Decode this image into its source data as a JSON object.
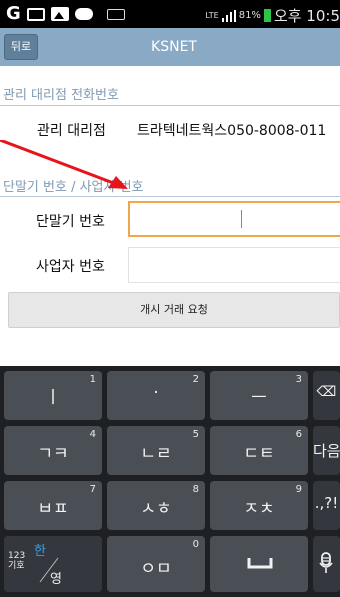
{
  "status_bar": {
    "signal_type": "LTE",
    "battery_percent": "81%",
    "time": "오후 10:5"
  },
  "app": {
    "title": "KSNET",
    "back_label": "뒤로"
  },
  "sections": {
    "manager": {
      "header": "관리 대리점 전화번호",
      "label": "관리 대리점",
      "value": "트라텍네트웍스050-8008-011"
    },
    "terminal": {
      "header": "단말기 번호 / 사업자 번호",
      "terminal_label": "단말기 번호",
      "terminal_value": "",
      "business_label": "사업자 번호",
      "business_value": ""
    }
  },
  "actions": {
    "open_request": "개시 거래 요청"
  },
  "keyboard": {
    "rows": [
      [
        {
          "label": "ㅣ",
          "sup": "1",
          "name": "key-i"
        },
        {
          "label": "·",
          "sup": "2",
          "name": "key-dot"
        },
        {
          "label": "ㅡ",
          "sup": "3",
          "name": "key-eu"
        },
        {
          "label": "⌫",
          "sup": "",
          "name": "key-backspace"
        }
      ],
      [
        {
          "label": "ㄱㅋ",
          "sup": "4",
          "name": "key-giyeok"
        },
        {
          "label": "ㄴㄹ",
          "sup": "5",
          "name": "key-nieun"
        },
        {
          "label": "ㄷㅌ",
          "sup": "6",
          "name": "key-digeut"
        },
        {
          "label": "다음",
          "sup": "",
          "name": "key-next"
        }
      ],
      [
        {
          "label": "ㅂㅍ",
          "sup": "7",
          "name": "key-bieup"
        },
        {
          "label": "ㅅㅎ",
          "sup": "8",
          "name": "key-siot"
        },
        {
          "label": "ㅈㅊ",
          "sup": "9",
          "name": "key-jieut"
        },
        {
          "label": ".,?!",
          "sup": "",
          "name": "key-punct"
        }
      ],
      [
        {
          "label": "123\n기호",
          "sup": "",
          "name": "key-symbols"
        },
        {
          "label": "ㅇㅁ",
          "sup": "0",
          "name": "key-ieung"
        },
        {
          "label": "␣",
          "sup": "",
          "name": "key-space"
        },
        {
          "label": "🎤",
          "sup": "",
          "name": "key-voice"
        }
      ]
    ],
    "lang_han": "한",
    "lang_eng": "영",
    "num_top": "123",
    "num_bottom": "기호"
  },
  "colors": {
    "titlebar": "#8aa9c5",
    "back_button": "#5f7f9b",
    "section_header": "#7f9ab3",
    "focus_border": "#f0a64a",
    "annotation_arrow": "#e8131b",
    "battery": "#2ec24d",
    "keyboard_bg": "#1e2024",
    "key_bg": "#4a4f56"
  }
}
